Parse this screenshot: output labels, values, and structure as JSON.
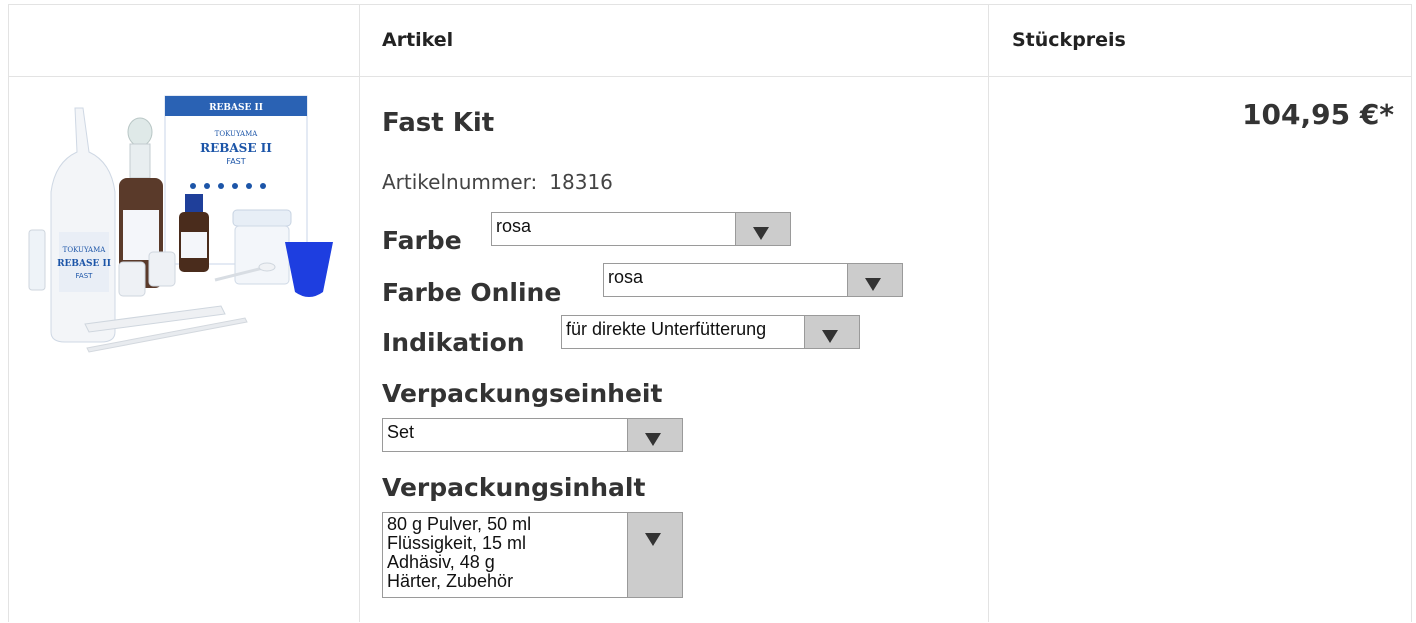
{
  "table": {
    "header": {
      "artikel": "Artikel",
      "stueckpreis": "Stückpreis"
    }
  },
  "product": {
    "title": "Fast Kit",
    "artikelnummer_label": "Artikelnummer:",
    "artikelnummer_value": "18316",
    "price": "104,95 €*",
    "image_alt": "TOKUYAMA REBASE II FAST",
    "image_text": {
      "brand": "TOKUYAMA",
      "product": "REBASE II",
      "variant": "FAST"
    }
  },
  "options": {
    "farbe": {
      "label": "Farbe",
      "value": "rosa"
    },
    "farbe_online": {
      "label": "Farbe Online",
      "value": "rosa"
    },
    "indikation": {
      "label": "Indikation",
      "value": "für direkte Unterfütterung"
    },
    "verpackungseinheit": {
      "label": "Verpackungseinheit",
      "value": "Set"
    },
    "verpackungsinhalt": {
      "label": "Verpackungsinhalt",
      "value": "80 g Pulver, 50 ml Flüssigkeit, 15 ml Adhäsiv, 48 g Härter, Zubehör"
    }
  },
  "colors": {
    "border": "#e3e3e3",
    "select_button": "#cccccc",
    "text": "#333333",
    "product_blue": "#1c55a8"
  }
}
